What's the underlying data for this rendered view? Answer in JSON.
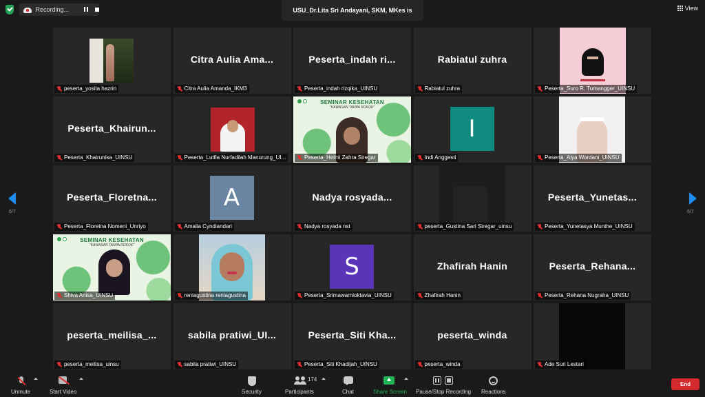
{
  "topbar": {
    "recording_label": "Recording...",
    "talking_banner": "USU_Dr.Lita Sri Andayani, SKM, MKes is talking...",
    "view_label": "View"
  },
  "pager": {
    "left": "6/7",
    "right": "6/7"
  },
  "tiles": [
    {
      "type": "video",
      "video": "garden",
      "label": "peserta_yosita hazrin"
    },
    {
      "type": "name",
      "name": "Citra Aulia Ama...",
      "label": "Citra Aulia Amanda_IKM3"
    },
    {
      "type": "name",
      "name": "Peserta_indah ri...",
      "label": "Peserta_indah rizqika_UINSU"
    },
    {
      "type": "name",
      "name": "Rabiatul zuhra",
      "label": "Rabiatul zuhra"
    },
    {
      "type": "video",
      "video": "hijab-pink",
      "label": "Peserta_Suro R. Tumangger_UINSU"
    },
    {
      "type": "name",
      "name": "Peserta_Khairun...",
      "label": "Peserta_Khairunisa_UINSU"
    },
    {
      "type": "video",
      "video": "passport",
      "label": "Peserta_Lutfia Nurfadilah Manurung_UI..."
    },
    {
      "type": "video",
      "video": "seminar",
      "label": "Peserta_Helmi Zahra Siregar"
    },
    {
      "type": "avatar",
      "letter": "I",
      "color": "#0f8a7e",
      "label": "Indi Anggesti"
    },
    {
      "type": "video",
      "video": "cream",
      "label": "Peserta_Alya Wardani_UINSU"
    },
    {
      "type": "name",
      "name": "Peserta_Floretna...",
      "label": "Peserta_Floretna Nomeni_Unriyo"
    },
    {
      "type": "avatar",
      "letter": "A",
      "color": "#6a86a3",
      "label": "Amalia Cyndiandari"
    },
    {
      "type": "name",
      "name": "Nadya rosyada...",
      "label": "Nadya rosyada nst"
    },
    {
      "type": "video",
      "video": "dark",
      "label": "peserta_Gustina Sari Siregar_uinsu"
    },
    {
      "type": "name",
      "name": "Peserta_Yunetas...",
      "label": "Peserta_Yunetasya Munthe_UINSU"
    },
    {
      "type": "video",
      "video": "seminar2",
      "label": "Shiva Anisa_UINSU"
    },
    {
      "type": "video",
      "video": "reni",
      "label": "reniagustina reniagustina"
    },
    {
      "type": "avatar",
      "letter": "S",
      "color": "#5a35b8",
      "label": "Peserta_Srimawarnioktavia_UINSU"
    },
    {
      "type": "name",
      "name": "Zhafirah Hanin",
      "label": "Zhafirah Hanin"
    },
    {
      "type": "name",
      "name": "Peserta_Rehana...",
      "label": "Peserta_Rehana Nugraha_UINSU"
    },
    {
      "type": "name",
      "name": "peserta_meilisa_...",
      "label": "peserta_meilisa_uinsu"
    },
    {
      "type": "name",
      "name": "sabila pratiwi_UI...",
      "label": "sabila pratiwi_UINSU"
    },
    {
      "type": "name",
      "name": "Peserta_Siti Kha...",
      "label": "Peserta_Siti Khadijah_UINSU"
    },
    {
      "type": "name",
      "name": "peserta_winda",
      "label": "peserta_winda"
    },
    {
      "type": "video",
      "video": "black",
      "label": "Ade Suri Lestari"
    }
  ],
  "seminar": {
    "title": "SEMINAR KESEHATAN",
    "subtitle": "\"KAWASAN TANPA ROKOK\""
  },
  "toolbar": {
    "unmute": "Unmute",
    "start_video": "Start Video",
    "security": "Security",
    "participants": "Participants",
    "participant_count": "174",
    "chat": "Chat",
    "share_screen": "Share Screen",
    "pause_stop_recording": "Pause/Stop Recording",
    "reactions": "Reactions",
    "end": "End"
  },
  "colors": {
    "accent_blue": "#1b8df2",
    "share_green": "#23b255",
    "end_red": "#d3282c",
    "muted_red": "#e02f2f"
  }
}
